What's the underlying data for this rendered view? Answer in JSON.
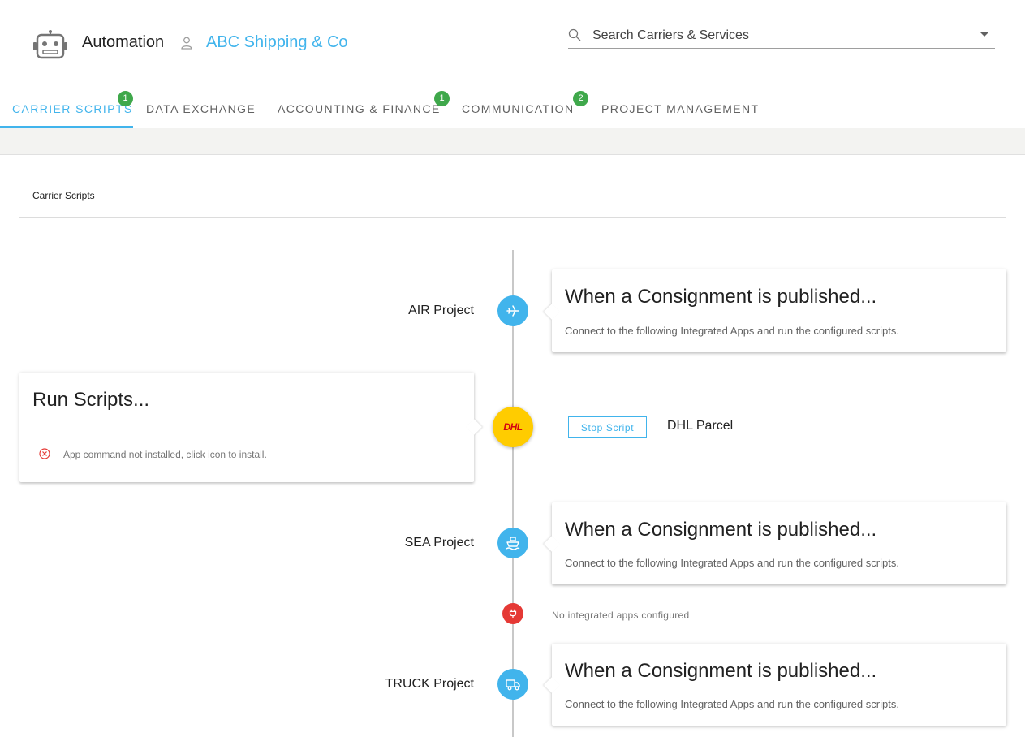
{
  "header": {
    "app_title": "Automation",
    "company_name": "ABC Shipping & Co",
    "search_placeholder": "Search Carriers & Services"
  },
  "tabs": [
    {
      "label": "CARRIER SCRIPTS",
      "badge": "1",
      "active": true
    },
    {
      "label": "DATA EXCHANGE",
      "badge": ""
    },
    {
      "label": "ACCOUNTING & FINANCE",
      "badge": "1"
    },
    {
      "label": "COMMUNICATION",
      "badge": "2"
    },
    {
      "label": "PROJECT MANAGEMENT",
      "badge": ""
    }
  ],
  "section": {
    "title": "Carrier Scripts"
  },
  "timeline": {
    "air": {
      "label": "AIR Project",
      "icon": "plane-icon",
      "card_title": "When a Consignment is published...",
      "card_sub": "Connect to the following Integrated Apps and run the configured scripts."
    },
    "dhl": {
      "logo_text": "DHL",
      "run_title": "Run Scripts...",
      "error_text": "App command not installed, click icon to install.",
      "stop_label": "Stop Script",
      "carrier_name": "DHL Parcel"
    },
    "sea": {
      "label": "SEA Project",
      "icon": "ship-icon",
      "card_title": "When a Consignment is published...",
      "card_sub": "Connect to the following Integrated Apps and run the configured scripts."
    },
    "no_apps": {
      "icon": "plug-icon",
      "text": "No integrated apps configured"
    },
    "truck": {
      "label": "TRUCK Project",
      "icon": "truck-icon",
      "card_title": "When a Consignment is published...",
      "card_sub": "Connect to the following Integrated Apps and run the configured scripts."
    }
  },
  "colors": {
    "accent": "#41b4ec",
    "badge": "#3fa84b",
    "dhl_yellow": "#ffcc00",
    "dhl_red": "#d40511",
    "error": "#e53935"
  }
}
